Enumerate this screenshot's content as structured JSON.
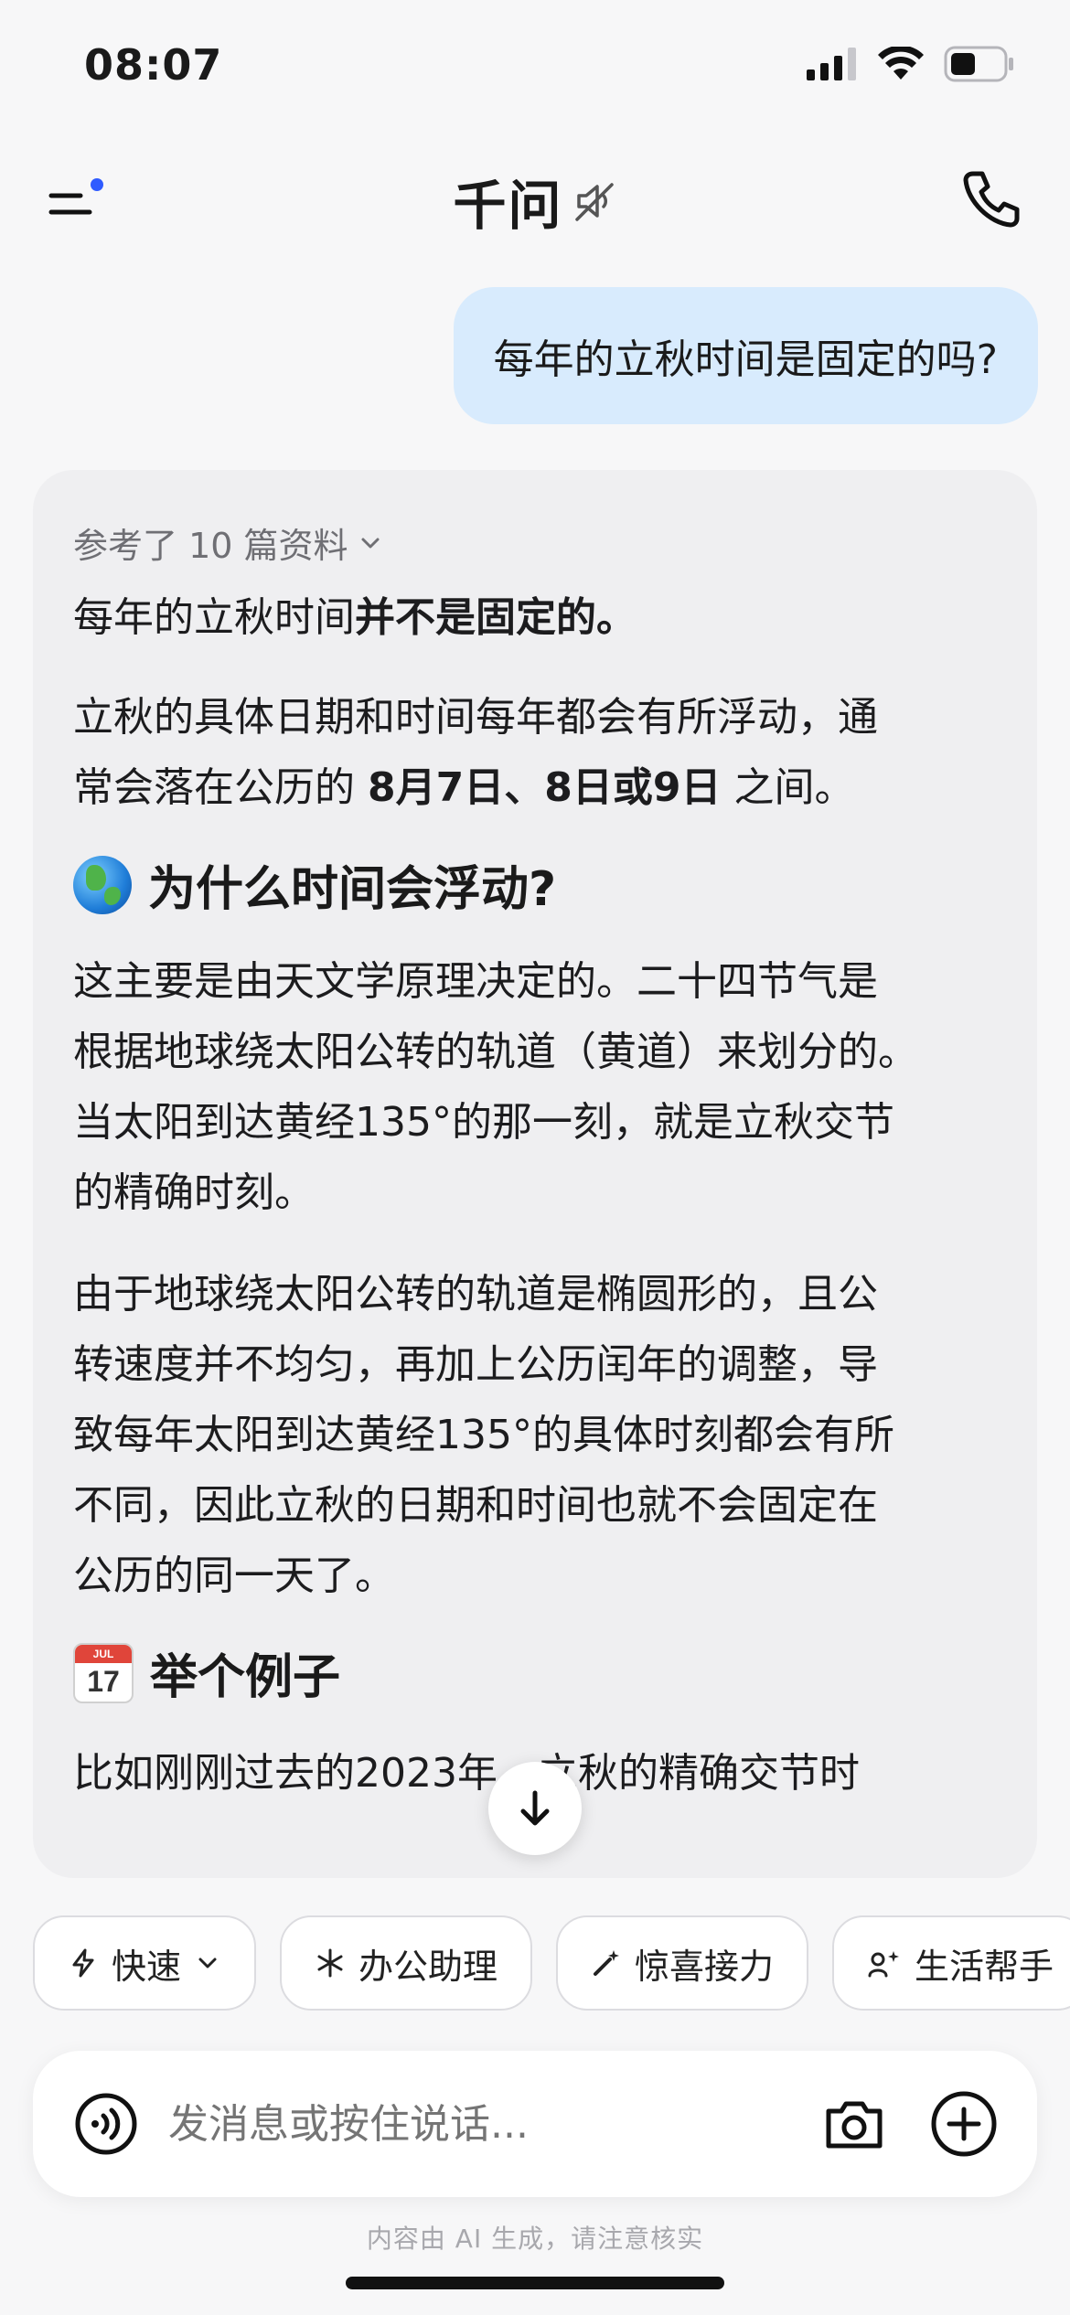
{
  "status_bar": {
    "time": "08:07"
  },
  "header": {
    "title": "千问"
  },
  "user_message": "每年的立秋时间是固定的吗?",
  "answer": {
    "refs_label": "参考了 10 篇资料",
    "p1_prefix": "每年的立秋时间",
    "p1_bold": "并不是固定的。",
    "p2_line1": "立秋的具体日期和时间每年都会有所浮动，通",
    "p2_line2_prefix": "常会落在公历的 ",
    "p2_line2_bold": "8月7日、8日或9日",
    "p2_line2_suffix": " 之间。",
    "h1": "为什么时间会浮动?",
    "p3_lines": [
      "这主要是由天文学原理决定的。二十四节气是",
      "根据地球绕太阳公转的轨道（黄道）来划分的。",
      "当太阳到达黄经135°的那一刻，就是立秋交节",
      "的精确时刻。"
    ],
    "p4_lines": [
      "由于地球绕太阳公转的轨道是椭圆形的，且公",
      "转速度并不均匀，再加上公历闰年的调整，导",
      "致每年太阳到达黄经135°的具体时刻都会有所",
      "不同，因此立秋的日期和时间也就不会固定在",
      "公历的同一天了。"
    ],
    "h2": "举个例子",
    "calendar_emoji": {
      "month": "JUL",
      "day": "17"
    },
    "cut_line": "比如刚刚过去的2023年，立秋的精确交节时"
  },
  "chips": [
    {
      "label": "快速",
      "icon": "lightning-icon"
    },
    {
      "label": "办公助理",
      "icon": "sparkle-icon"
    },
    {
      "label": "惊喜接力",
      "icon": "magic-wand-icon"
    },
    {
      "label": "生活帮手",
      "icon": "life-helper-icon"
    }
  ],
  "input": {
    "placeholder": "发消息或按住说话..."
  },
  "disclaimer": "内容由 AI 生成，请注意核实"
}
